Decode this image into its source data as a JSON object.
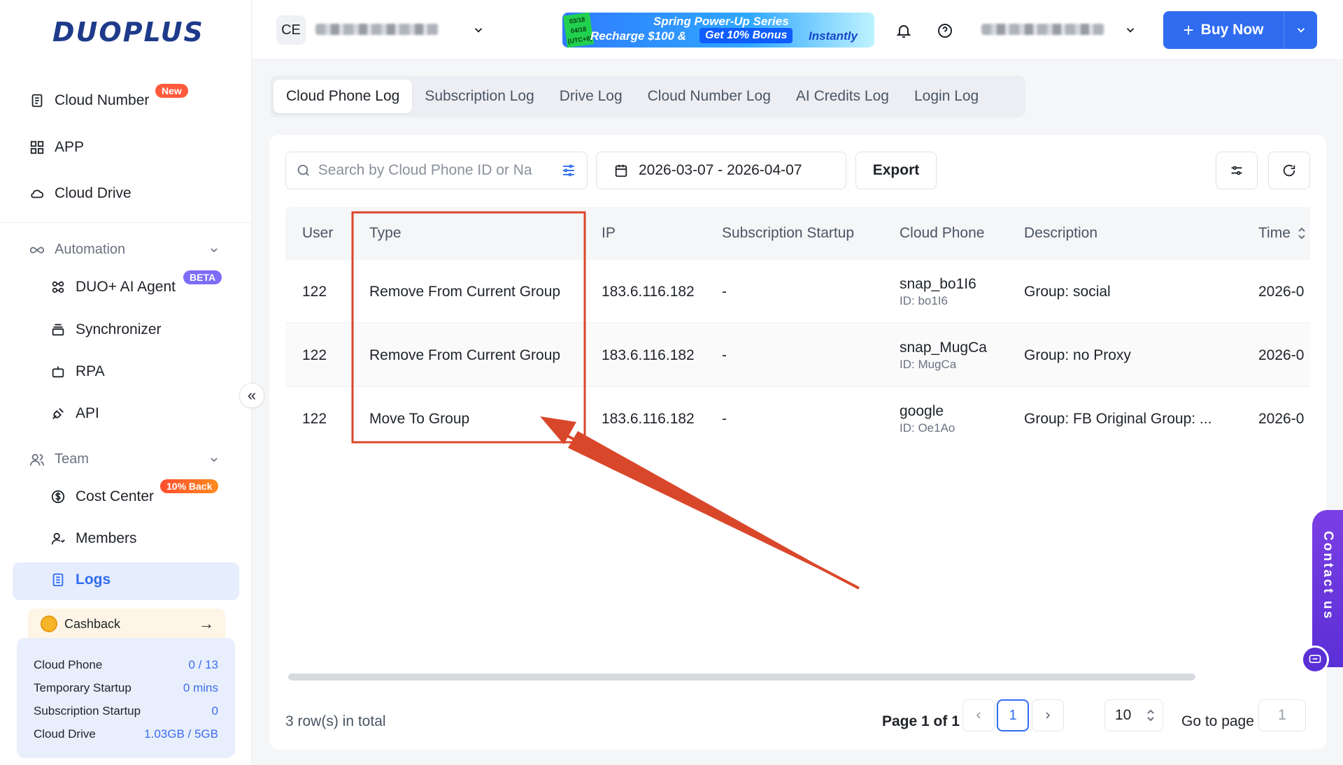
{
  "brand": {
    "logo_text": "DUOPLUS"
  },
  "sidebar": {
    "items": [
      {
        "label": "Cloud Number",
        "badge": "New"
      },
      {
        "label": "APP"
      },
      {
        "label": "Cloud Drive"
      }
    ],
    "automation": {
      "label": "Automation",
      "children": [
        {
          "label": "DUO+ AI Agent",
          "badge": "BETA"
        },
        {
          "label": "Synchronizer"
        },
        {
          "label": "RPA"
        },
        {
          "label": "API"
        }
      ]
    },
    "team": {
      "label": "Team",
      "children": [
        {
          "label": "Cost Center",
          "badge": "10% Back"
        },
        {
          "label": "Members"
        },
        {
          "label": "Logs"
        }
      ]
    },
    "cashback": {
      "label": "Cashback",
      "arrow": "→"
    },
    "usage": [
      {
        "label": "Cloud Phone",
        "value": "0 / 13"
      },
      {
        "label": "Temporary Startup",
        "value": "0 mins"
      },
      {
        "label": "Subscription Startup",
        "value": "0"
      },
      {
        "label": "Cloud Drive",
        "value": "1.03GB / 5GB"
      }
    ],
    "collapse_glyph": "«"
  },
  "topbar": {
    "team_initials": "CE",
    "promo": {
      "dates": "03/18\n04/18\n(UTC+8)",
      "title": "Spring Power-Up Series",
      "line1": "Recharge $100 &",
      "highlight": "Get 10% Bonus",
      "line2": "Instantly"
    },
    "buy_label": "Buy Now",
    "buy_plus": "+"
  },
  "tabs": [
    "Cloud Phone Log",
    "Subscription Log",
    "Drive Log",
    "Cloud Number Log",
    "AI Credits Log",
    "Login Log"
  ],
  "toolbar": {
    "search_placeholder": "Search by Cloud Phone ID or Na",
    "date_range": "2026-03-07 - 2026-04-07",
    "export_label": "Export"
  },
  "table": {
    "columns": [
      "User",
      "Type",
      "IP",
      "Subscription Startup",
      "Cloud Phone",
      "Description",
      "Time"
    ],
    "rows": [
      {
        "user": "122",
        "type": "Remove From Current Group",
        "ip": "183.6.116.182",
        "sub": "-",
        "phone": "snap_bo1I6",
        "phone_id": "ID: bo1I6",
        "desc": "Group: social",
        "time": "2026-0"
      },
      {
        "user": "122",
        "type": "Remove From Current Group",
        "ip": "183.6.116.182",
        "sub": "-",
        "phone": "snap_MugCa",
        "phone_id": "ID: MugCa",
        "desc": "Group: no Proxy",
        "time": "2026-0"
      },
      {
        "user": "122",
        "type": "Move To Group",
        "ip": "183.6.116.182",
        "sub": "-",
        "phone": "google",
        "phone_id": "ID: Oe1Ao",
        "desc": "Group: FB Original Group: ...",
        "time": "2026-0"
      }
    ]
  },
  "footer": {
    "total": "3 row(s) in total",
    "page_text": "Page 1 of 1",
    "current_page": "1",
    "page_size": "10",
    "goto_label": "Go to page",
    "goto_value": "1"
  },
  "contact": {
    "label": "Contact us"
  },
  "colors": {
    "accent": "#2f6cf0",
    "annotation": "#d9472b",
    "badge_new": "#ff5a3c",
    "badge_beta": "#7c6cf6"
  }
}
